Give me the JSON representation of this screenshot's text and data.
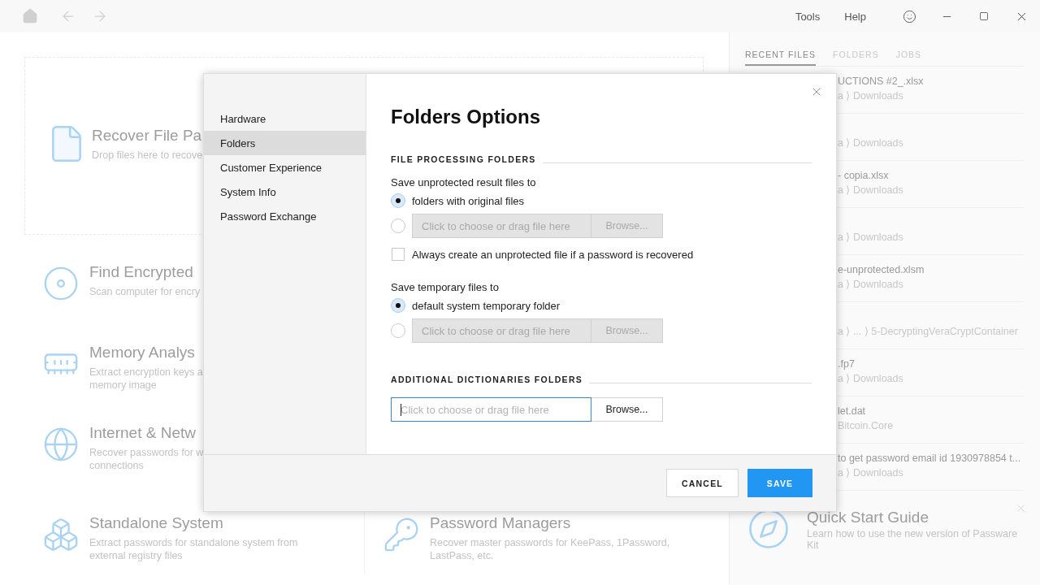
{
  "toolbar": {
    "menu": [
      {
        "label": "Tools"
      },
      {
        "label": "Help"
      }
    ]
  },
  "main": {
    "drop_card": {
      "title": "Recover File Pa",
      "subtitle": "Drop files here to recove"
    },
    "tile_rows": [
      [
        {
          "kind": "disc",
          "title": "Find Encrypted",
          "description_lines": [
            "Scan computer for encry"
          ]
        }
      ],
      [
        {
          "kind": "memory",
          "title": "Memory Analys",
          "description_lines": [
            "Extract encryption keys a",
            "memory image"
          ]
        }
      ],
      [
        {
          "kind": "globe",
          "title": "Internet & Netw",
          "description_lines": [
            "Recover passwords for w",
            "connections"
          ]
        }
      ],
      [
        {
          "kind": "cubes",
          "title": "Standalone System",
          "description_lines": [
            "Extract passwords for standalone system from",
            "external registry files"
          ]
        },
        {
          "kind": "keys",
          "title": "Password Managers",
          "description_lines": [
            "Recover master passwords for KeePass, 1Password,",
            "LastPass, etc."
          ]
        }
      ]
    ]
  },
  "side_panel": {
    "tabs": [
      {
        "label": "RECENT FILES",
        "selected": true
      },
      {
        "label": "FOLDERS",
        "selected": false
      },
      {
        "label": "JOBS",
        "selected": false
      }
    ],
    "recent_files": [
      {
        "name": "UCTIONS #2_.xlsx",
        "path": "a ⟩ Downloads"
      },
      {
        "path": "a ⟩ Downloads"
      },
      {
        "name": "- copia.xlsx",
        "path": "a ⟩ Downloads"
      },
      {
        "path": "a ⟩ Downloads"
      },
      {
        "name": "e-unprotected.xlsm",
        "path": "a ⟩ Downloads"
      },
      {
        "path": "a ⟩ ...  ⟩ 5-DecryptingVeraCryptContainer"
      },
      {
        "name": ".fp7",
        "path": "a ⟩ Downloads"
      },
      {
        "name": "let.dat",
        "path": "Bitcoin.Core"
      },
      {
        "name": "to get password email id 1930978854 t...",
        "path": "a ⟩ Downloads"
      }
    ],
    "quick_start": {
      "title": "Quick Start Guide",
      "description": "Learn how to use the new version of Passware Kit"
    }
  },
  "dialog": {
    "nav": [
      {
        "label": "Hardware",
        "selected": false
      },
      {
        "label": "Folders",
        "selected": true
      },
      {
        "label": "Customer Experience",
        "selected": false
      },
      {
        "label": "System Info",
        "selected": false
      },
      {
        "label": "Password Exchange",
        "selected": false
      }
    ],
    "title": "Folders Options",
    "sections": [
      {
        "heading": "FILE PROCESSING FOLDERS",
        "items": [
          {
            "kind": "label",
            "text": "Save unprotected result files to"
          },
          {
            "kind": "radio",
            "selected": true,
            "label": "folders with original files"
          },
          {
            "kind": "radio_path",
            "selected": false,
            "placeholder": "Click to choose or drag file here",
            "button": "Browse...",
            "disabled": true
          },
          {
            "kind": "checkbox",
            "checked": false,
            "label": "Always create an unprotected file if a password is recovered"
          },
          {
            "kind": "label",
            "text": "Save temporary files to"
          },
          {
            "kind": "radio",
            "selected": true,
            "label": "default system temporary folder"
          },
          {
            "kind": "radio_path",
            "selected": false,
            "placeholder": "Click to choose or drag file here",
            "button": "Browse...",
            "disabled": true
          }
        ]
      },
      {
        "heading": "ADDITIONAL DICTIONARIES FOLDERS",
        "items": [
          {
            "kind": "path",
            "placeholder": "Click to choose or drag file here",
            "button": "Browse...",
            "disabled": false,
            "focused": true
          }
        ]
      }
    ],
    "buttons": [
      {
        "kind": "secondary",
        "label": "CANCEL"
      },
      {
        "kind": "primary",
        "label": "SAVE"
      }
    ]
  }
}
